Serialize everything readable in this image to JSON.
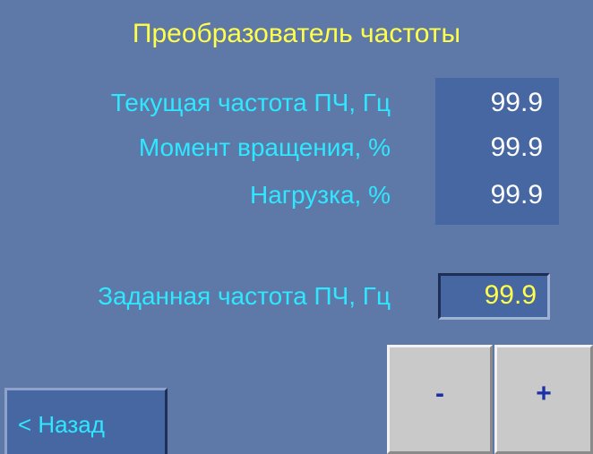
{
  "screen": {
    "title": "Преобразователь частоты"
  },
  "readouts": [
    {
      "label": "Текущая частота ПЧ, Гц",
      "value": "99.9"
    },
    {
      "label": "Момент вращения, %",
      "value": "99.9"
    },
    {
      "label": "Нагрузка, %",
      "value": "99.9"
    }
  ],
  "setpoint": {
    "label": "Заданная частота ПЧ, Гц",
    "value": "99.9"
  },
  "controls": {
    "minus_label": "-",
    "plus_label": "+",
    "back_label": "< Назад"
  },
  "colors": {
    "background": "#5e78a8",
    "panel": "#4767a3",
    "title": "#ffff4a",
    "label": "#2ee8ff",
    "value": "#ffffff",
    "setpoint_value": "#ffff4a",
    "button_face": "#c9c9c9",
    "button_text": "#1a2fa8"
  }
}
